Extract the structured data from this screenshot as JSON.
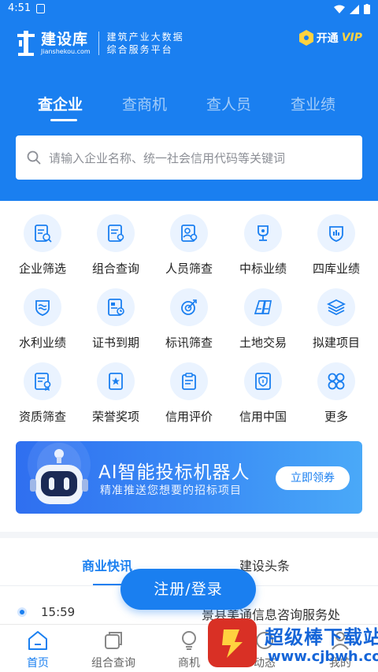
{
  "status_bar": {
    "time": "4:51"
  },
  "brand": {
    "name": "建设库",
    "domain": "Jianshekou.com",
    "slogan_line1": "建筑产业大数据",
    "slogan_line2": "综合服务平台",
    "vip_prefix": "开通",
    "vip_word": "VIP"
  },
  "tabs": [
    {
      "label": "查企业",
      "active": true
    },
    {
      "label": "查商机",
      "active": false
    },
    {
      "label": "查人员",
      "active": false
    },
    {
      "label": "查业绩",
      "active": false
    }
  ],
  "search": {
    "placeholder": "请输入企业名称、统一社会信用代码等关键词"
  },
  "features": [
    {
      "label": "企业筛选",
      "icon": "company-filter-icon"
    },
    {
      "label": "组合查询",
      "icon": "combined-query-icon"
    },
    {
      "label": "人员筛查",
      "icon": "personnel-search-icon"
    },
    {
      "label": "中标业绩",
      "icon": "trophy-icon"
    },
    {
      "label": "四库业绩",
      "icon": "chart-badge-icon"
    },
    {
      "label": "水利业绩",
      "icon": "water-badge-icon"
    },
    {
      "label": "证书到期",
      "icon": "certificate-icon"
    },
    {
      "label": "标讯筛查",
      "icon": "target-icon"
    },
    {
      "label": "土地交易",
      "icon": "land-icon"
    },
    {
      "label": "拟建项目",
      "icon": "layers-icon"
    },
    {
      "label": "资质筛查",
      "icon": "qualification-icon"
    },
    {
      "label": "荣誉奖项",
      "icon": "honor-icon"
    },
    {
      "label": "信用评价",
      "icon": "clipboard-icon"
    },
    {
      "label": "信用中国",
      "icon": "shield-doc-icon"
    },
    {
      "label": "更多",
      "icon": "more-grid-icon"
    }
  ],
  "banner": {
    "title": "AI智能投标机器人",
    "subtitle": "精准推送您想要的招标项目",
    "button": "立即领券"
  },
  "news": {
    "tabs": [
      "商业快讯",
      "建设头条"
    ],
    "items": [
      {
        "time": "15:59",
        "text": "景县美通信息咨询服务处"
      }
    ]
  },
  "login_button": "注册/登录",
  "bottom_nav": [
    {
      "label": "首页",
      "icon": "home-icon",
      "active": true
    },
    {
      "label": "组合查询",
      "icon": "stack-icon",
      "active": false
    },
    {
      "label": "商机",
      "icon": "bulb-icon",
      "active": false
    },
    {
      "label": "动态",
      "icon": "activity-icon",
      "active": false
    },
    {
      "label": "我的",
      "icon": "user-icon",
      "active": false
    }
  ],
  "watermark": {
    "name": "超级棒下载站",
    "url": "www.cjbwh.com"
  },
  "colors": {
    "primary": "#1a7ff0",
    "vip_gold": "#ffd23f",
    "icon_bg": "#eaf3ff"
  }
}
